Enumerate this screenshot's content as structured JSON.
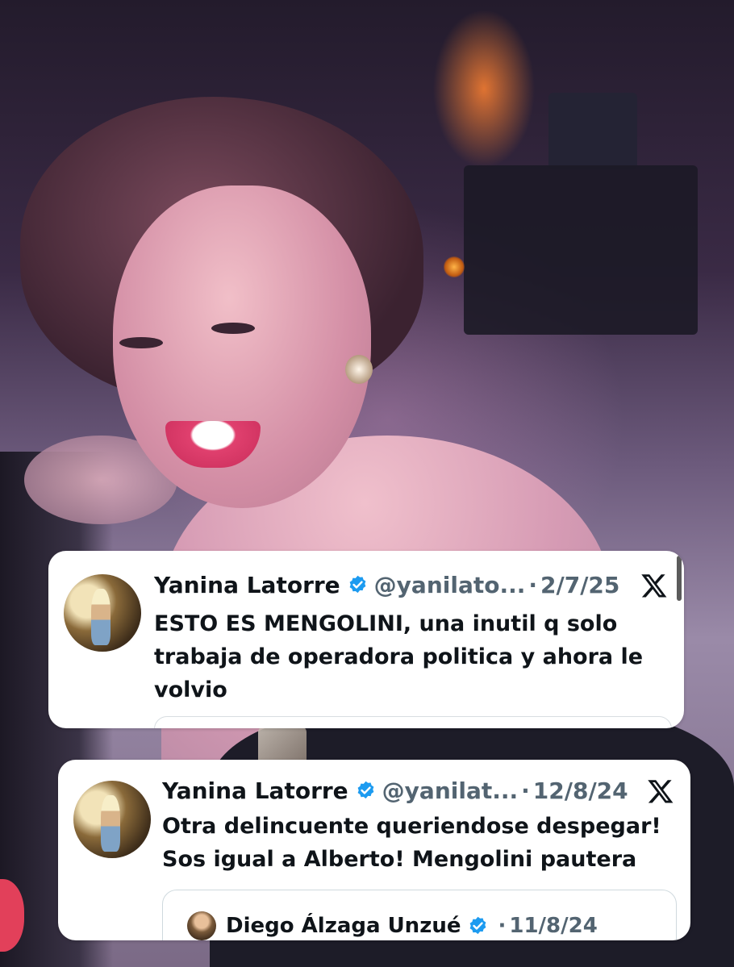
{
  "tweets": [
    {
      "author_name": "Yanina Latorre",
      "handle": "@yanilato...",
      "separator": "·",
      "date": "2/7/25",
      "text_lines": [
        "ESTO ES MENGOLINI, una inutil q solo",
        "trabaja de operadora politica y ahora le",
        "volvio"
      ],
      "verified_icon": "verified-badge-icon",
      "platform_icon": "x-logo-icon"
    },
    {
      "author_name": "Yanina Latorre",
      "handle": "@yanilat...",
      "separator": "·",
      "date": "12/8/24",
      "text_lines": [
        "Otra delincuente queriendose despegar!",
        "Sos igual a Alberto! Mengolini pautera"
      ],
      "verified_icon": "verified-badge-icon",
      "platform_icon": "x-logo-icon",
      "quoted": {
        "author_name": "Diego Álzaga Unzué",
        "separator": "·",
        "date": "11/8/24",
        "verified_icon": "verified-badge-icon"
      }
    }
  ],
  "colors": {
    "verified_blue": "#1d9bf0",
    "text_primary": "#0f1419",
    "text_secondary": "#536471",
    "card_bg": "#ffffff"
  }
}
